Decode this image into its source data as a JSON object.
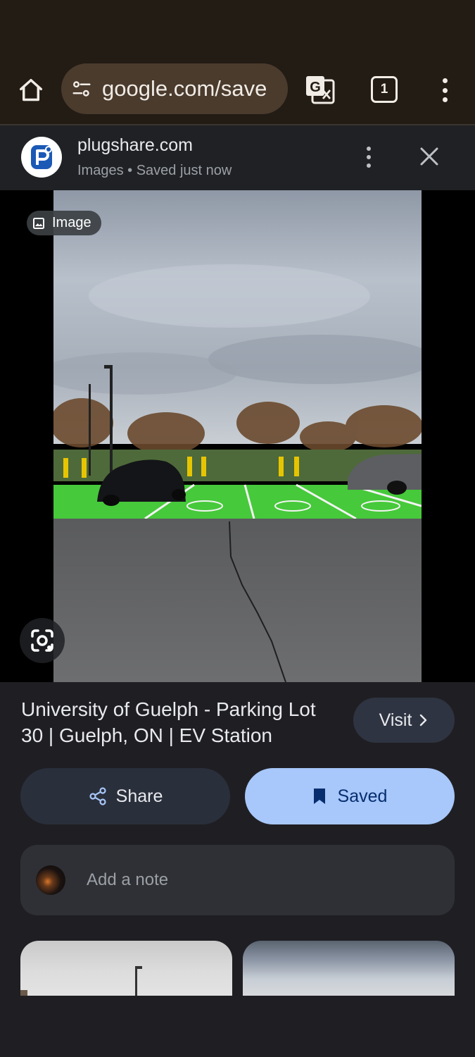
{
  "browser": {
    "url": "google.com/save",
    "tab_count": "1"
  },
  "saved_header": {
    "site": "plugshare.com",
    "meta": "Images • Saved just now"
  },
  "viewer": {
    "chip_label": "Image"
  },
  "result": {
    "title": "University of Guelph - Parking Lot 30 | Guelph, ON | EV Station",
    "visit_label": "Visit"
  },
  "actions": {
    "share_label": "Share",
    "saved_label": "Saved"
  },
  "note": {
    "placeholder": "Add a note"
  }
}
